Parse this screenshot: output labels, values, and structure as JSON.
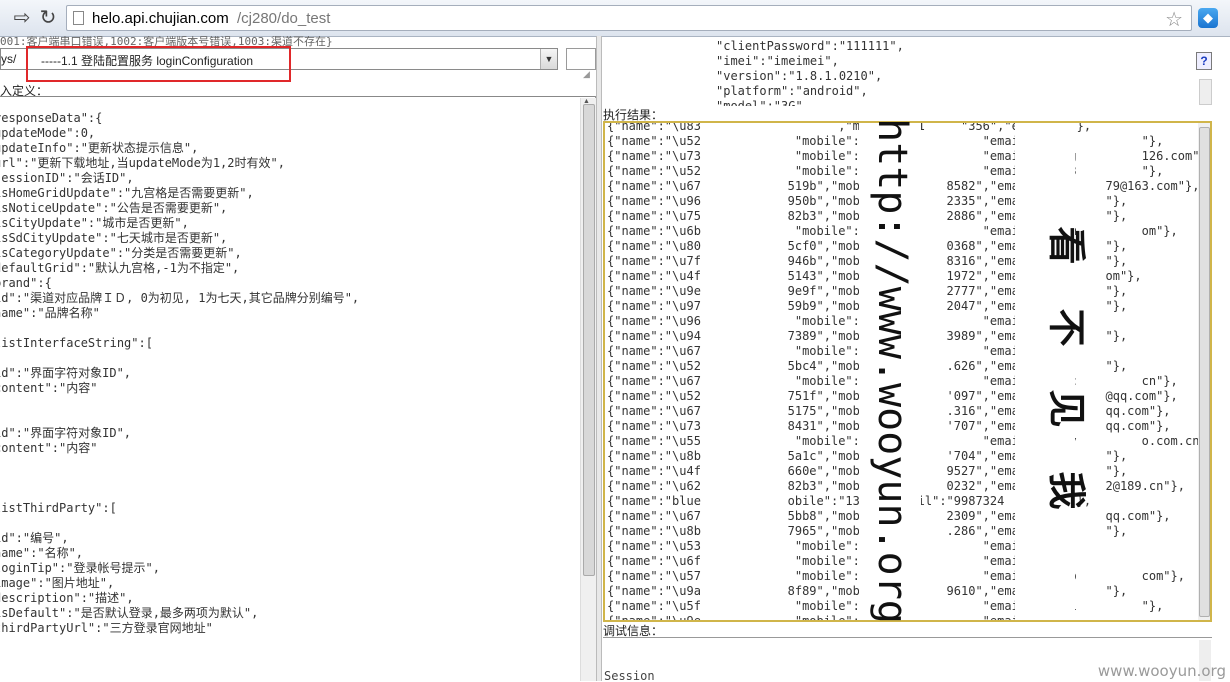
{
  "browser": {
    "url_host": "helo.api.chujian.com",
    "url_path": "/cj280/do_test",
    "back_icon": "back-arrow-icon",
    "reload_icon": "reload-icon",
    "star_icon": "star-icon"
  },
  "left": {
    "error_codes": "001:客户端串口错误,1002:客户端版本号错误,1003:渠道不存在}",
    "api_path": "ys/",
    "api_selected": "-----1.1 登陆配置服务 loginConfiguration",
    "def_label": "入定义：",
    "def_lines": [
      "responseData\":{",
      "updateMode\":0,",
      "updateInfo\":\"更新状态提示信息\",",
      "url\":\"更新下载地址,当updateMode为1,2时有效\",",
      "sessionID\":\"会话ID\",",
      "isHomeGridUpdate\":\"九宫格是否需要更新\",",
      "isNoticeUpdate\":\"公告是否需要更新\",",
      "isCityUpdate\":\"城市是否更新\",",
      "isSdCityUpdate\":\"七天城市是否更新\",",
      "isCategoryUpdate\":\"分类是否需要更新\",",
      "defaultGrid\":\"默认九宫格,-1为不指定\",",
      "brand\":{",
      "id\":\"渠道对应品牌ＩＤ, 0为初见, 1为七天,其它品牌分别编号\",",
      "name\":\"品牌名称\"",
      "",
      "listInterfaceString\":[",
      "",
      "id\":\"界面字符对象ID\",",
      "content\":\"内容\"",
      "",
      "",
      "id\":\"界面字符对象ID\",",
      "content\":\"内容\"",
      "",
      "",
      "",
      "listThirdParty\":[",
      "",
      "id\":\"编号\",",
      "name\":\"名称\",",
      "loginTip\":\"登录帐号提示\",",
      "image\":\"图片地址\",",
      "description\":\"描述\",",
      "isDefault\":\"是否默认登录,最多两项为默认\",",
      "thirdPartyUrl\":\"三方登录官网地址\""
    ]
  },
  "right": {
    "req_lines": [
      "\"clientPassword\":\"111111\",",
      "\"imei\":\"imeimei\",",
      "\"version\":\"1.8.1.0210\",",
      "\"platform\":\"android\",",
      "\"model\":\"3G\""
    ],
    "help_label": "?",
    "result_label": "执行结果：",
    "result_rows": [
      "{\"name\":\"\\u830                  ,\"mobile\":\"1     \"356\",\"email\":\"\"},",
      "{\"name\":\"\\u521            \"mobile\":\"137             \"email\":\"446          \"},",
      "{\"name\":\"\\u738            \"mobile\":\"186             \"email\":\"wang         126.com\"},",
      "{\"name\":\"\\u521            \"mobile\":\"139             \"email\":\"6253         \"},",
      "{\"name\":\"\\u673           519b\",\"mobile         8582\",\"email\"         79@163.com\"},",
      "{\"name\":\"\\u964           950b\",\"mobile         2335\",\"email\"         \"},",
      "{\"name\":\"\\u753           82b3\",\"mobile         2886\",\"email\"         \"},",
      "{\"name\":\"\\u6bc            \"mobile\":\"139             \"email\":\"lanm         om\"},",
      "{\"name\":\"\\u809           5cf0\",\"mobile         0368\",\"email\"         \"},",
      "{\"name\":\"\\u7f5           946b\",\"mobile         8316\",\"email\"         \"},",
      "{\"name\":\"\\u4f5           5143\",\"mobile         1972\",\"email\"         om\"},",
      "{\"name\":\"\\u9e8           9e9f\",\"mobile         2777\",\"email\"         \"},",
      "{\"name\":\"\\u97e           59b9\",\"mobile         2047\",\"email\"         \"},",
      "{\"name\":\"\\u964            \"mobile\":\"136             \"email\":\"\"},",
      "{\"name\":\"\\u949           7389\",\"mobile         3989\",\"email\"         \"},",
      "{\"name\":\"\\u674            \"mobile\":\"137             \"email\":\"\"},",
      "{\"name\":\"\\u521           5bc4\",\"mobile         .626\",\"email\"         \"},",
      "{\"name\":\"\\u673            \"mobile\":\"138             \"email\":\"zhuc         cn\"},",
      "{\"name\":\"\\u521           751f\",\"mobile         '097\",\"email\"         @qq.com\"},",
      "{\"name\":\"\\u673           5175\",\"mobile         .316\",\"email\"         qq.com\"},",
      "{\"name\":\"\\u738           8431\",\"mobile         '707\",\"email\"         qq.com\"},",
      "{\"name\":\"\\u551            \"mobile\":\"188             \"email\":\"lily         o.com.cn\"},",
      "{\"name\":\"\\u8bb           5a1c\",\"mobile         '704\",\"email\"         \"},",
      "{\"name\":\"\\u4fc           660e\",\"mobile         9527\",\"email\"         \"},",
      "{\"name\":\"\\u623           82b3\",\"mobile         0232\",\"email\"         2@189.cn\"},",
      "{\"name\":\"bluem           obile\":\"139111   ail\":\"9987324         \"},",
      "{\"name\":\"\\u674           5bb8\",\"mobile         2309\",\"email\"         qq.com\"},",
      "{\"name\":\"\\u8bb           7965\",\"mobile         .286\",\"email\"         \"},",
      "{\"name\":\"\\u536            \"mobile\":\"159             \"email\":\"\"},",
      "{\"name\":\"\\u6f5            \"mobile\":\"157             \"email\":\"\"},",
      "{\"name\":\"\\u571            \"mobile\":\"136             \"email\":\"liub         com\"},",
      "{\"name\":\"\\u9a6           8f89\",\"mobile         9610\",\"email\"         \"},",
      "{\"name\":\"\\u5f2            \"mobile\":\"134             \"email\":\"2001         \"},",
      "{\"name\":\"\\u9ec            \"mobile\":\"187             \"email\":\"\"}"
    ],
    "debug_label": "调试信息：",
    "debug_text": "Session"
  },
  "watermarks": {
    "vertical_url": "http://www.wooyun.org",
    "vertical_cn": [
      "看",
      "不",
      "见",
      "我"
    ],
    "site": "www.wooyun.org"
  },
  "colors": {
    "highlight": "#e0282a",
    "result_border": "#d0b54a"
  }
}
